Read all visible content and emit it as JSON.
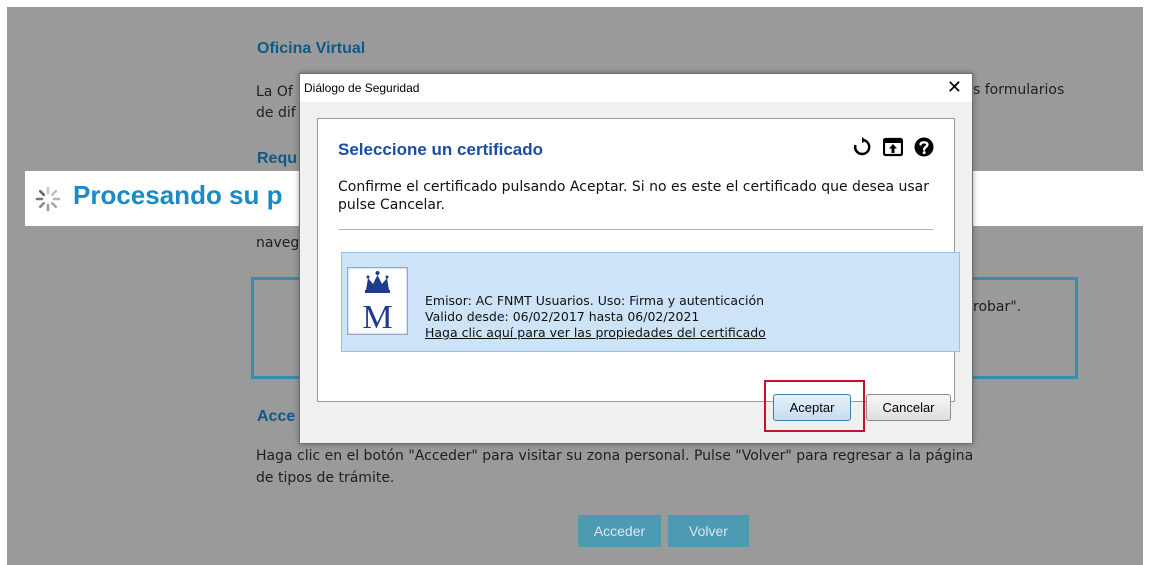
{
  "page": {
    "heading_office": "Oficina Virtual",
    "text_line1_left": "La Of",
    "text_line1_right": "s formularios",
    "text_line2_left": "de dif",
    "heading_req": "Requ",
    "text_naveg": "naveg",
    "text_box_right": "robar\".",
    "heading_acce": "Acce",
    "access_paragraph_line1": "Haga clic en el botón \"Acceder\" para visitar su zona personal. Pulse \"Volver\" para regresar a la página",
    "access_paragraph_line2": "de tipos de trámite.",
    "btn_acceder": "Acceder",
    "btn_volver": "Volver"
  },
  "processing": {
    "text": "Procesando su p"
  },
  "dialog": {
    "title": "Diálogo de Seguridad",
    "close_glyph": "✕",
    "panel_title": "Seleccione un certificado",
    "instructions": "Confirme el certificado pulsando Aceptar. Si no es este el certificado que desea usar pulse Cancelar.",
    "icons": [
      "refresh-icon",
      "import-icon",
      "help-icon"
    ],
    "certificate": {
      "issuer_line": "Emisor: AC FNMT Usuarios. Uso: Firma y autenticación",
      "valid_line": "Valido desde: 06/02/2017 hasta 06/02/2021",
      "link_text": "Haga clic aquí para ver las propiedades del certificado",
      "logo_letter": "M"
    },
    "accept_label": "Aceptar",
    "cancel_label": "Cancelar"
  },
  "colors": {
    "overlay": "#9a9a9a",
    "heading": "#0e5a86",
    "processing_text": "#1a8bc4",
    "panel_title": "#1a4ea3",
    "cert_card": "#cde3f7",
    "highlight": "#c4122a"
  }
}
